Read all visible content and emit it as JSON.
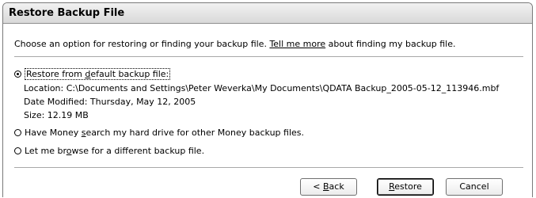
{
  "window": {
    "title": "Restore Backup File"
  },
  "intro": {
    "before_link": "Choose an option for restoring or finding your backup file. ",
    "link": "Tell me more",
    "after_link": " about finding my backup file."
  },
  "options": {
    "default": {
      "label_pre": "Restore from ",
      "label_accel": "d",
      "label_post": "efault backup file:",
      "selected": true,
      "location": "Location: C:\\Documents and Settings\\Peter Weverka\\My Documents\\QDATA Backup_2005-05-12_113946.mbf",
      "date_modified": "Date Modified: Thursday, May 12, 2005",
      "size": "Size: 12.19 MB"
    },
    "search": {
      "label_pre": "Have Money ",
      "label_accel": "s",
      "label_post": "earch my hard drive for other Money backup files.",
      "selected": false
    },
    "browse": {
      "label_pre": "Let me br",
      "label_accel": "o",
      "label_post": "wse for a different backup file.",
      "selected": false
    }
  },
  "buttons": {
    "back_pre": "< ",
    "back_accel": "B",
    "back_post": "ack",
    "restore_accel": "R",
    "restore_post": "estore",
    "cancel": "Cancel"
  }
}
